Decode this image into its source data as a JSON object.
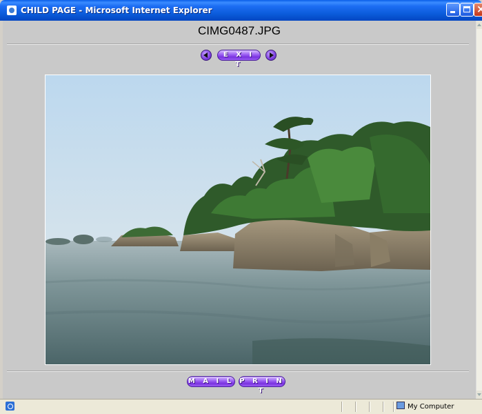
{
  "window": {
    "title": "CHILD PAGE - Microsoft Internet Explorer"
  },
  "page": {
    "image_caption": "CIMG0487.JPG",
    "nav": {
      "prev_icon": "left-arrow-round-icon",
      "exit_label": "E X I T",
      "next_icon": "right-arrow-round-icon"
    },
    "photo_description_icon": "photo",
    "actions": {
      "mail_label": "M A I L",
      "print_label": "P R I N T"
    }
  },
  "statusbar": {
    "zone_label": "My Computer",
    "zone_icon": "computer-icon"
  },
  "colors": {
    "button_purple": "#9a5cf2",
    "titlebar_blue": "#0a5ad8",
    "content_gray": "#c9c9c9"
  }
}
